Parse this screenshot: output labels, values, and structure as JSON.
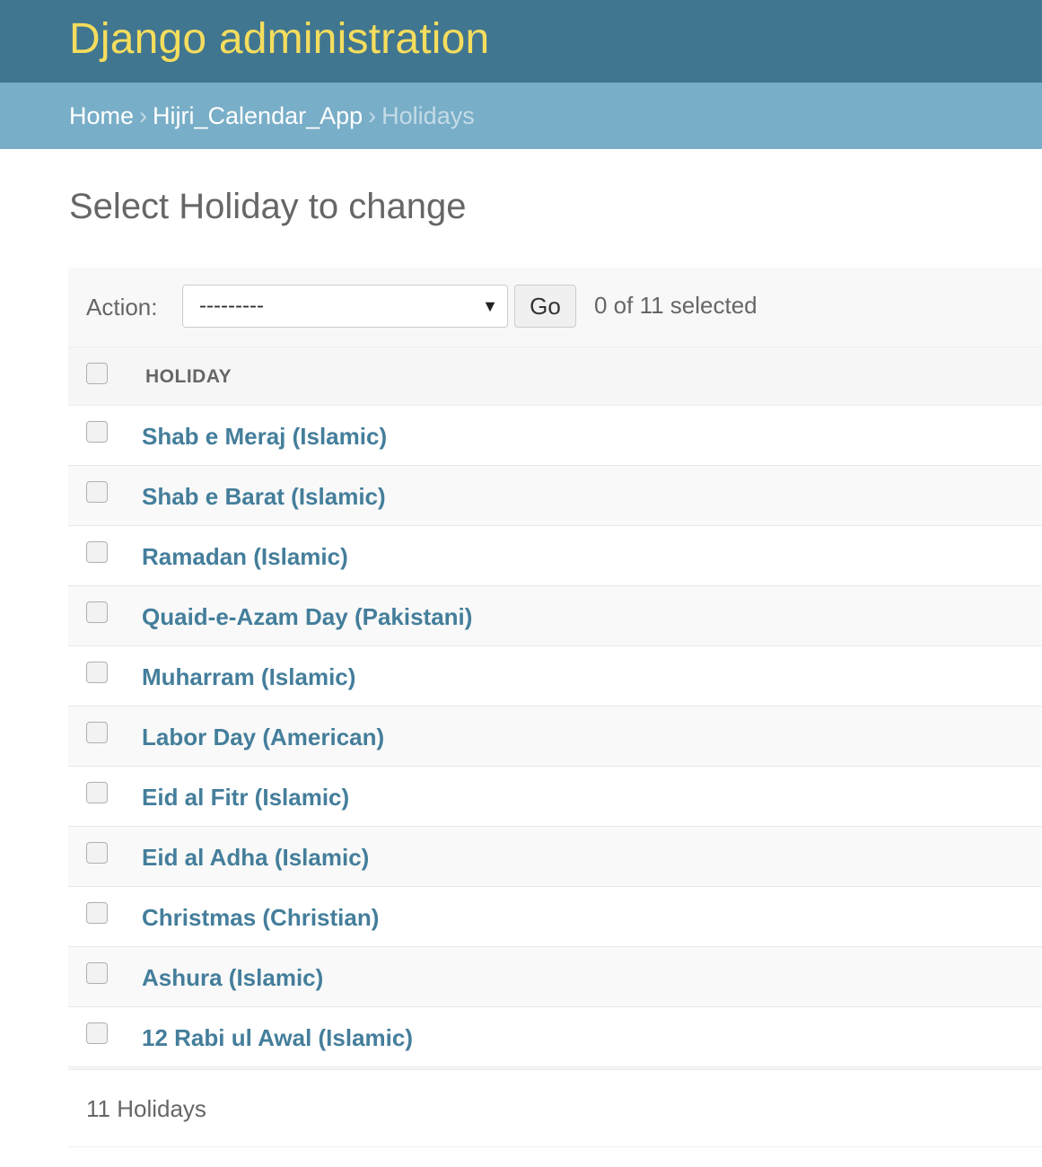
{
  "header": {
    "branding": "Django administration"
  },
  "breadcrumbs": {
    "home": "Home",
    "app": "Hijri_Calendar_App",
    "current": "Holidays",
    "separator": "›"
  },
  "page": {
    "title": "Select Holiday to change"
  },
  "actions": {
    "label": "Action:",
    "selected_value": "---------",
    "go_label": "Go",
    "counter": "0 of 11 selected"
  },
  "table": {
    "column_header": "HOLIDAY",
    "rows": [
      "Shab e Meraj (Islamic)",
      "Shab e Barat (Islamic)",
      "Ramadan (Islamic)",
      "Quaid-e-Azam Day (Pakistani)",
      "Muharram (Islamic)",
      "Labor Day (American)",
      "Eid al Fitr (Islamic)",
      "Eid al Adha (Islamic)",
      "Christmas (Christian)",
      "Ashura (Islamic)",
      "12 Rabi ul Awal (Islamic)"
    ]
  },
  "paginator": {
    "text": "11 Holidays"
  },
  "colors": {
    "header_bg": "#417690",
    "branding": "#f5dd5d",
    "breadcrumbs_bg": "#79aec8",
    "link": "#447e9b"
  }
}
